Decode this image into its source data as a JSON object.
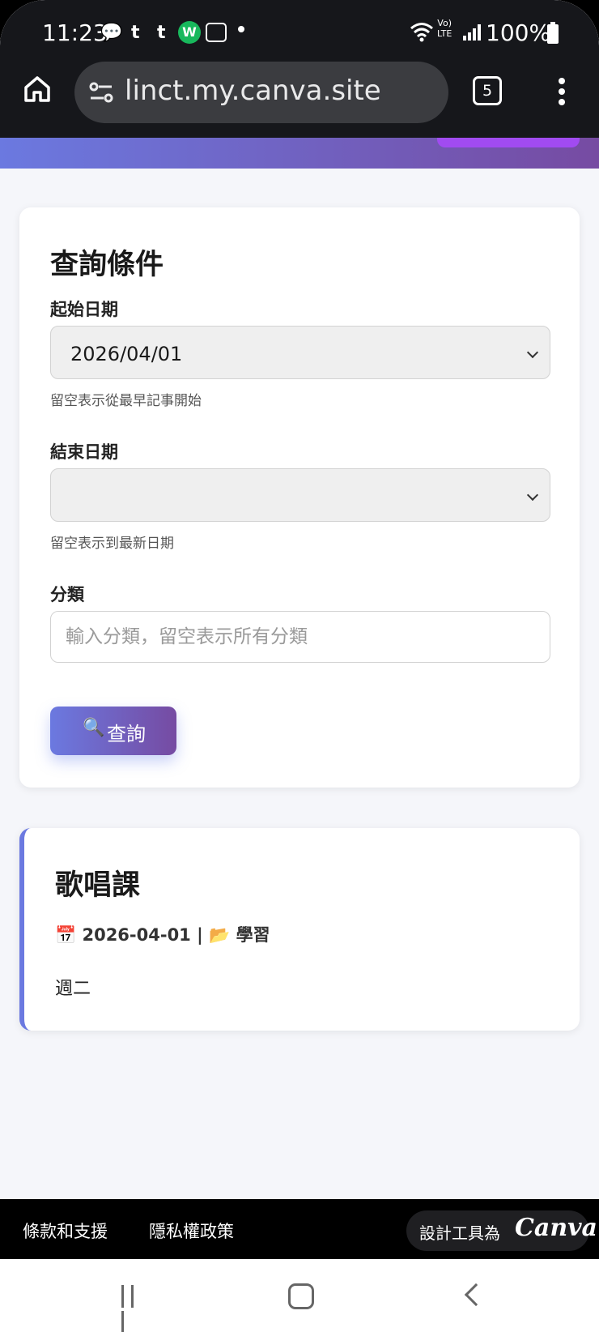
{
  "status_bar": {
    "time": "11:23",
    "battery": "100%",
    "volte": "Vo)\nLTE"
  },
  "browser": {
    "url": "linct.my.canva.site",
    "tab_count": "5"
  },
  "query_card": {
    "title": "查詢條件",
    "start_date": {
      "label": "起始日期",
      "value": "2026/04/01",
      "hint": "留空表示從最早記事開始"
    },
    "end_date": {
      "label": "結束日期",
      "value": "",
      "hint": "留空表示到最新日期"
    },
    "category": {
      "label": "分類",
      "placeholder": "輸入分類，留空表示所有分類",
      "value": ""
    },
    "search_button": {
      "icon": "🔍",
      "label": "查詢"
    }
  },
  "entries": [
    {
      "title": "歌唱課",
      "date_icon": "📅",
      "date": "2026-04-01",
      "separator": "|",
      "category_icon": "📂",
      "category": "學習",
      "description": "週二"
    }
  ],
  "footer": {
    "terms": "條款和支援",
    "privacy": "隱私權政策",
    "made_with": "設計工具為",
    "brand": "Canva"
  },
  "colors": {
    "accent_start": "#6b79e0",
    "accent_end": "#764ba2",
    "header_pill": "#a14bf1"
  }
}
